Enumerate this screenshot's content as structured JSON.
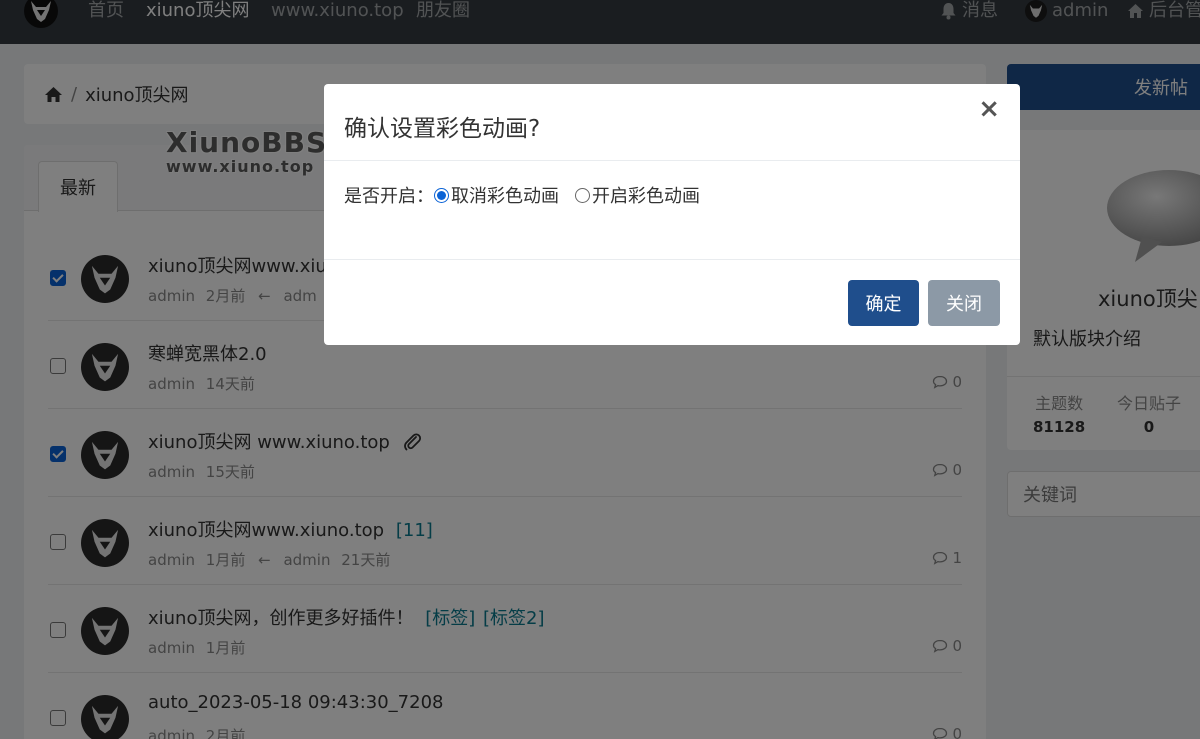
{
  "nav": {
    "items": [
      "首页",
      "xiuno顶尖网",
      "www.xiuno.top",
      "朋友圈"
    ],
    "messages": "消息",
    "user": "admin",
    "admin": "后台管"
  },
  "breadcrumb": {
    "current": "xiuno顶尖网"
  },
  "watermark": {
    "line1": "XiunoBBS",
    "line2": "www.xiuno.top"
  },
  "tabs": [
    "最新"
  ],
  "threads": [
    {
      "checked": true,
      "title": "xiuno顶尖网www.xiu",
      "tags": [],
      "author": "admin",
      "time": "2月前",
      "last_author": "adm",
      "last_time": "",
      "count": ""
    },
    {
      "checked": false,
      "title": "寒蝉宽黑体2.0",
      "tags": [],
      "author": "admin",
      "time": "14天前",
      "last_author": "",
      "last_time": "",
      "count": "0"
    },
    {
      "checked": true,
      "title": "xiuno顶尖网 www.xiuno.top",
      "tags": [],
      "attachment": true,
      "author": "admin",
      "time": "15天前",
      "last_author": "",
      "last_time": "",
      "count": "0"
    },
    {
      "checked": false,
      "title": "xiuno顶尖网www.xiuno.top",
      "tags": [
        "[11]"
      ],
      "author": "admin",
      "time": "1月前",
      "last_author": "admin",
      "last_time": "21天前",
      "count": "1"
    },
    {
      "checked": false,
      "title": "xiuno顶尖网，创作更多好插件！",
      "tags": [
        "[标签]",
        "[标签2]"
      ],
      "author": "admin",
      "time": "1月前",
      "last_author": "",
      "last_time": "",
      "count": "0"
    },
    {
      "checked": false,
      "title": "auto_2023-05-18 09:43:30_7208",
      "tags": [],
      "author": "admin",
      "time": "2月前",
      "last_author": "",
      "last_time": "",
      "count": "0"
    }
  ],
  "sidebar": {
    "post_button": "发新帖",
    "forum_name": "xiuno顶尖",
    "forum_intro": "默认版块介绍",
    "stats": [
      {
        "label": "主题数",
        "value": "81128"
      },
      {
        "label": "今日贴子",
        "value": "0"
      }
    ],
    "search_placeholder": "关键词"
  },
  "modal": {
    "title": "确认设置彩色动画?",
    "close_symbol": "×",
    "field_label": "是否开启：",
    "options": [
      "取消彩色动画",
      "开启彩色动画"
    ],
    "selected_option": "取消彩色动画",
    "confirm_label": "确定",
    "close_label": "关闭"
  },
  "colors": {
    "navbar": "#343a40",
    "primary": "#1f4e8c",
    "secondary": "#8c99a6",
    "checkbox": "#0b63d6",
    "tag": "#0b7a8f"
  }
}
